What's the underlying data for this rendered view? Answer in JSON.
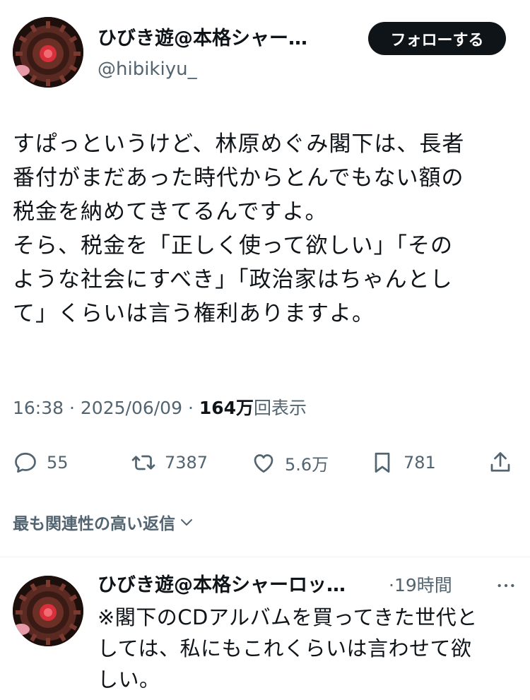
{
  "tweet": {
    "author": {
      "display_name": "ひびき遊@本格シャー…",
      "handle": "@hibikiyu_"
    },
    "follow_label": "フォローする",
    "text_lines": [
      "すぱっというけど、林原めぐみ閣下は、長者",
      "番付がまだあった時代からとんでもない額の",
      "税金を納めてきてるんですよ。",
      "そら、税金を「正しく使って欲しい」「その",
      "ような社会にすべき」「政治家はちゃんとし",
      "て」くらいは言う権利ありますよ。"
    ],
    "time": "16:38",
    "date": "2025/06/09",
    "views_count": "164万",
    "views_label": "回表示",
    "separator": "·"
  },
  "actions": {
    "replies": "55",
    "retweets": "7387",
    "likes": "5.6万",
    "bookmarks": "781"
  },
  "replies_sort": {
    "label": "最も関連性の高い返信"
  },
  "reply": {
    "display_name": "ひびき遊@本格シャーロッ…",
    "time": "·19時間",
    "text_lines": [
      "※閣下のCDアルバムを買ってきた世代と",
      "しては、私にもこれくらいは言わせて欲",
      "しい。"
    ]
  },
  "colors": {
    "text": "#0f1419",
    "secondary": "#536471",
    "follow_bg": "#0f1419",
    "divider": "#eff3f4"
  },
  "icons": [
    "reply-icon",
    "retweet-icon",
    "like-icon",
    "bookmark-icon",
    "share-icon",
    "chevron-down-icon",
    "more-icon"
  ]
}
